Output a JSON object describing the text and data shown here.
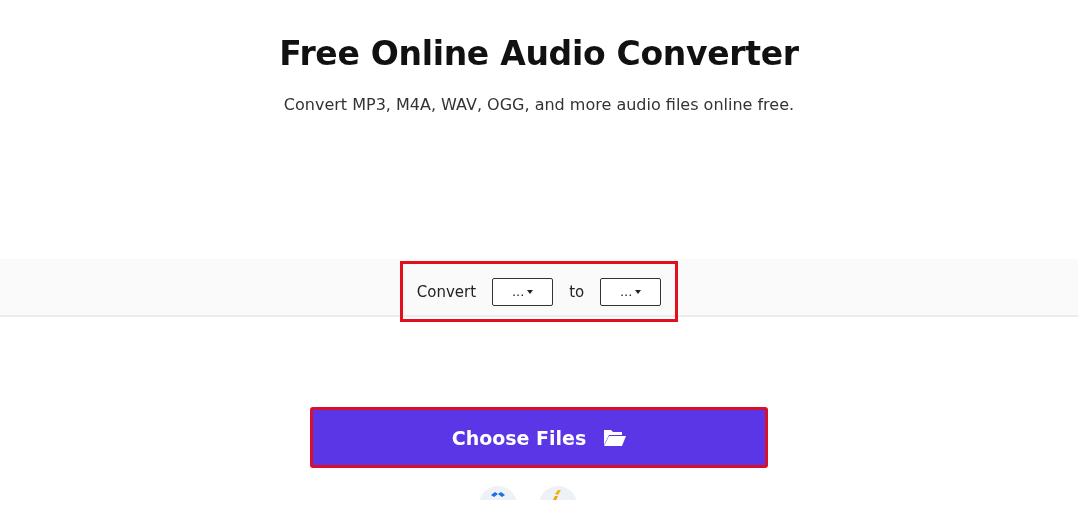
{
  "title": "Free Online Audio Converter",
  "subtitle": "Convert MP3, M4A, WAV, OGG, and more audio files online free.",
  "converter": {
    "label": "Convert",
    "from": "...",
    "connector": "to",
    "to": "...",
    "highlighted": true
  },
  "choose_button": {
    "label": "Choose Files",
    "highlighted": true
  }
}
